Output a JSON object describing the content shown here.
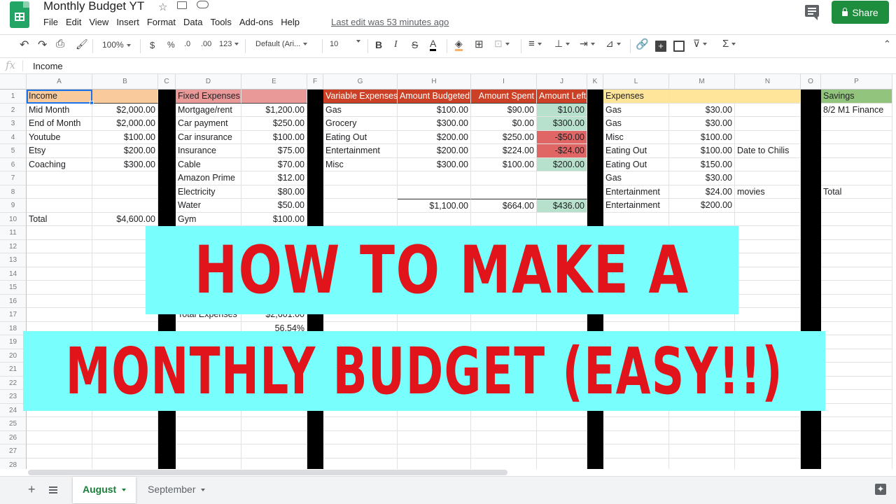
{
  "app": {
    "doc_title": "Monthly Budget YT",
    "menu": [
      "File",
      "Edit",
      "View",
      "Insert",
      "Format",
      "Data",
      "Tools",
      "Add-ons",
      "Help"
    ],
    "last_edit": "Last edit was 53 minutes ago",
    "share_label": "Share"
  },
  "toolbar": {
    "zoom": "100%",
    "currency": "$",
    "percent": "%",
    "dec_decrease": ".0",
    "dec_increase": ".00",
    "more_formats": "123",
    "font": "Default (Ari...",
    "font_size": "10",
    "bold": "B",
    "italic": "I",
    "strike": "S",
    "text_color": "A",
    "sum": "Σ"
  },
  "formula_bar": {
    "fx": "fx",
    "value": "Income"
  },
  "columns": [
    "A",
    "B",
    "C",
    "D",
    "E",
    "F",
    "G",
    "H",
    "I",
    "J",
    "K",
    "L",
    "M",
    "N",
    "O",
    "P"
  ],
  "rows": [
    "1",
    "2",
    "3",
    "4",
    "5",
    "6",
    "7",
    "8",
    "9",
    "10",
    "11",
    "12",
    "13",
    "14",
    "15",
    "16",
    "17",
    "18",
    "19",
    "20",
    "21",
    "22",
    "23",
    "24",
    "25",
    "26",
    "27",
    "28"
  ],
  "colors": {
    "income": "#f9cb9c",
    "fixed": "#ea9999",
    "variable": "#cc4125",
    "expenses": "#ffe599",
    "savings": "#93c47d",
    "positive": "#b7e1cd",
    "negative": "#e06666",
    "banner_bg": "#78fefd",
    "banner_text": "#e0141a",
    "share": "#1e8e3e"
  },
  "income": {
    "header": "Income",
    "items": [
      {
        "label": "Mid Month",
        "amount": "$2,000.00"
      },
      {
        "label": "End of Month",
        "amount": "$2,000.00"
      },
      {
        "label": "Youtube",
        "amount": "$100.00"
      },
      {
        "label": "Etsy",
        "amount": "$200.00"
      },
      {
        "label": "Coaching",
        "amount": "$300.00"
      }
    ],
    "total_label": "Total",
    "total": "$4,600.00"
  },
  "fixed": {
    "header": "Fixed Expenses",
    "items": [
      {
        "label": "Mortgage/rent",
        "amount": "$1,200.00"
      },
      {
        "label": "Car payment",
        "amount": "$250.00"
      },
      {
        "label": "Car insurance",
        "amount": "$100.00"
      },
      {
        "label": "Insurance",
        "amount": "$75.00"
      },
      {
        "label": "Cable",
        "amount": "$70.00"
      },
      {
        "label": "Amazon Prime",
        "amount": "$12.00"
      },
      {
        "label": "Electricity",
        "amount": "$80.00"
      },
      {
        "label": "Water",
        "amount": "$50.00"
      },
      {
        "label": "Gym",
        "amount": "$100.00"
      }
    ],
    "total_label": "Total Expenses",
    "total": "$2,601.00",
    "percent": "56.54%"
  },
  "variable": {
    "headers": [
      "Variable Expenses",
      "Amount Budgeted",
      "Amount Spent",
      "Amount Left"
    ],
    "items": [
      {
        "label": "Gas",
        "budgeted": "$100.00",
        "spent": "$90.00",
        "left": "$10.00",
        "status": "positive"
      },
      {
        "label": "Grocery",
        "budgeted": "$300.00",
        "spent": "$0.00",
        "left": "$300.00",
        "status": "positive"
      },
      {
        "label": "Eating Out",
        "budgeted": "$200.00",
        "spent": "$250.00",
        "left": "-$50.00",
        "status": "negative"
      },
      {
        "label": "Entertainment",
        "budgeted": "$200.00",
        "spent": "$224.00",
        "left": "-$24.00",
        "status": "negative"
      },
      {
        "label": "Misc",
        "budgeted": "$300.00",
        "spent": "$100.00",
        "left": "$200.00",
        "status": "positive"
      }
    ],
    "totals": {
      "budgeted": "$1,100.00",
      "spent": "$664.00",
      "left": "$436.00"
    }
  },
  "expenses": {
    "header": "Expenses",
    "items": [
      {
        "label": "Gas",
        "amount": "$30.00",
        "note": ""
      },
      {
        "label": "Gas",
        "amount": "$30.00",
        "note": ""
      },
      {
        "label": "Misc",
        "amount": "$100.00",
        "note": ""
      },
      {
        "label": "Eating Out",
        "amount": "$100.00",
        "note": "Date to Chilis"
      },
      {
        "label": "Eating Out",
        "amount": "$150.00",
        "note": ""
      },
      {
        "label": "Gas",
        "amount": "$30.00",
        "note": ""
      },
      {
        "label": "Entertainment",
        "amount": "$24.00",
        "note": "movies"
      },
      {
        "label": "Entertainment",
        "amount": "$200.00",
        "note": ""
      }
    ]
  },
  "savings": {
    "header": "Savings",
    "first": "8/2 M1 Finance",
    "total_label": "Total"
  },
  "banner": {
    "line1": "HOW TO MAKE A",
    "line2": "MONTHLY BUDGET (EASY!!)"
  },
  "sheets": {
    "tabs": [
      {
        "label": "August",
        "active": true
      },
      {
        "label": "September",
        "active": false
      }
    ]
  }
}
